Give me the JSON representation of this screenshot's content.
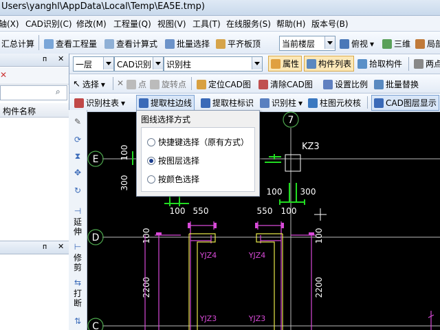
{
  "window": {
    "title": "Users\\yanghl\\AppData\\Local\\Temp\\EA5E.tmp)"
  },
  "menu": [
    "轴(X)",
    "CAD识别(C)",
    "修改(M)",
    "工程量(Q)",
    "视图(V)",
    "工具(T)",
    "在线服务(S)",
    "帮助(H)",
    "版本号(B)"
  ],
  "toolbar1": {
    "summary": "汇总计算",
    "view_quantity": "查看工程量",
    "view_formula": "查看计算式",
    "batch_select": "批量选择",
    "flat_roof": "平齐板顶",
    "floor_combo": "当前楼层",
    "top_view": "俯视",
    "three_d": "三维",
    "local": "局部"
  },
  "toolbar2": {
    "floor": "一层",
    "cad_recog": "CAD识别",
    "recog_column": "识别柱",
    "property": "属性",
    "component_list": "构件列表",
    "pick_component": "拾取构件",
    "two_point": "两点"
  },
  "toolbar3": {
    "select": "选择",
    "point": "点",
    "rotate_point": "旋转点",
    "locate_cad": "定位CAD图",
    "clear_cad": "清除CAD图",
    "set_scale": "设置比例",
    "batch_replace": "批量替换"
  },
  "toolbar4": {
    "recog_column_table": "识别柱表",
    "extract_edge": "提取柱边线",
    "extract_label": "提取柱标识",
    "recog_column": "识别柱",
    "detail_check": "柱图元校核",
    "cad_layer": "CAD图层显示"
  },
  "left_panel": {
    "column_header": "构件名称"
  },
  "vertical_tools": {
    "extend": "延伸",
    "trim": "修剪",
    "break": "打断"
  },
  "popup": {
    "title": "图线选择方式",
    "options": [
      {
        "label": "快捷键选择（原有方式）",
        "selected": false
      },
      {
        "label": "按图层选择",
        "selected": true
      },
      {
        "label": "按颜色选择",
        "selected": false
      }
    ]
  },
  "drawing": {
    "axes": [
      "E",
      "D",
      "C",
      "7"
    ],
    "component_label": "KZ3",
    "dims": [
      "100",
      "300",
      "100",
      "300",
      "100",
      "550",
      "550",
      "100",
      "100",
      "2200",
      "2200",
      "100"
    ],
    "yjz_labels": [
      "YJZ4",
      "YJZ4",
      "YJZ3",
      "YJZ3"
    ]
  },
  "colors": {
    "axis": "#4ea84e",
    "dim_magenta": "#d84ad8",
    "wall_yellow": "#e8e84a",
    "green": "#22dd22"
  }
}
